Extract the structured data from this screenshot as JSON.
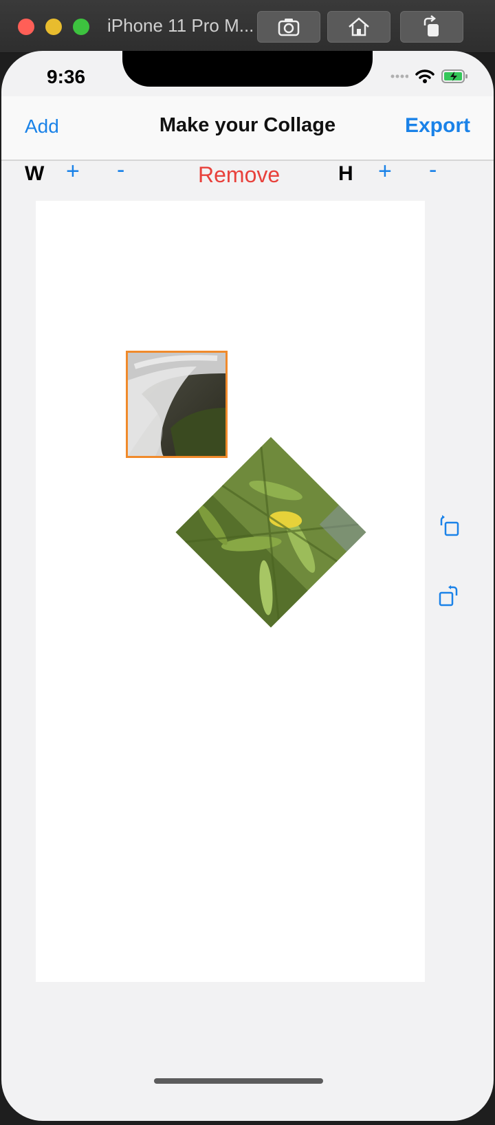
{
  "window": {
    "title": "iPhone 11 Pro M..."
  },
  "status_bar": {
    "time": "9:36"
  },
  "nav": {
    "left": "Add",
    "title": "Make your Collage",
    "right": "Export"
  },
  "controls": {
    "w_label": "W",
    "w_plus": "+",
    "w_minus": "-",
    "remove": "Remove",
    "h_label": "H",
    "h_plus": "+",
    "h_minus": "-"
  },
  "colors": {
    "accent": "#1a82e8",
    "destructive": "#e8413b",
    "selection": "#f08a2b"
  },
  "icons": [
    "screenshot-icon",
    "home-icon",
    "rotate-device-icon",
    "rotate-left-icon",
    "rotate-right-icon",
    "wifi-icon",
    "battery-icon"
  ]
}
